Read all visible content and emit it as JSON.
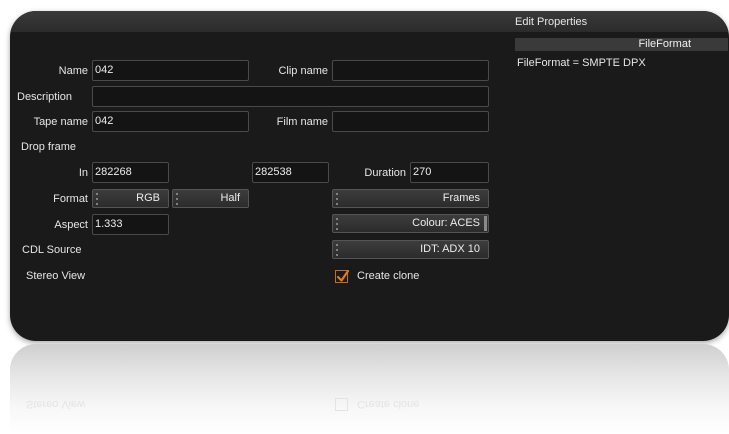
{
  "title": "Edit Properties",
  "file_format": {
    "header": "FileFormat",
    "value": "FileFormat = SMPTE DPX"
  },
  "form": {
    "name_label": "Name",
    "name_value": "042",
    "clip_name_label": "Clip name",
    "clip_name_value": "",
    "description_label": "Description",
    "description_value": "",
    "tape_name_label": "Tape name",
    "tape_name_value": "042",
    "film_name_label": "Film name",
    "film_name_value": "",
    "drop_frame_label": "Drop frame",
    "in_label": "In",
    "in_value": "282268",
    "out_value": "282538",
    "duration_label": "Duration",
    "duration_value": "270",
    "format_label": "Format",
    "format_value": "RGB",
    "depth_value": "Half",
    "timecode_mode_value": "Frames",
    "aspect_label": "Aspect",
    "aspect_value": "1.333",
    "colour_value": "Colour: ACES",
    "cdl_source_label": "CDL Source",
    "idt_value": "IDT: ADX 10",
    "stereo_view_label": "Stereo View",
    "create_clone_label": "Create clone",
    "create_clone_checked": true
  },
  "colors": {
    "panel_bg": "#1a1a1a",
    "accent_checkbox": "#e07a20"
  }
}
